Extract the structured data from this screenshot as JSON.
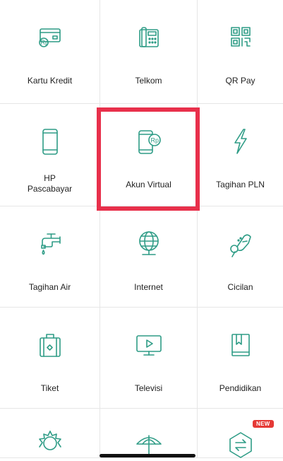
{
  "tiles": [
    {
      "label": "Kartu Kredit",
      "icon": "credit-card-icon"
    },
    {
      "label": "Telkom",
      "icon": "telephone-icon"
    },
    {
      "label": "QR Pay",
      "icon": "qr-code-icon"
    },
    {
      "label_line1": "HP",
      "label_line2": "Pascabayar",
      "icon": "mobile-phone-icon"
    },
    {
      "label": "Akun Virtual",
      "icon": "phone-rp-coin-icon"
    },
    {
      "label": "Tagihan PLN",
      "icon": "lightning-icon"
    },
    {
      "label": "Tagihan Air",
      "icon": "water-faucet-icon"
    },
    {
      "label": "Internet",
      "icon": "globe-icon"
    },
    {
      "label": "Cicilan",
      "icon": "hand-coin-icon"
    },
    {
      "label": "Tiket",
      "icon": "suitcase-icon"
    },
    {
      "label": "Televisi",
      "icon": "tv-play-icon"
    },
    {
      "label": "Pendidikan",
      "icon": "book-icon"
    }
  ],
  "rp_text": "Rp",
  "partial_row_icons": [
    "sun-icon",
    "umbrella-icon",
    "cube-arrow-icon"
  ],
  "badge_new": "NEW",
  "colors": {
    "icon": "#2e9c86",
    "highlight": "#e8304b",
    "badge": "#e53935"
  }
}
